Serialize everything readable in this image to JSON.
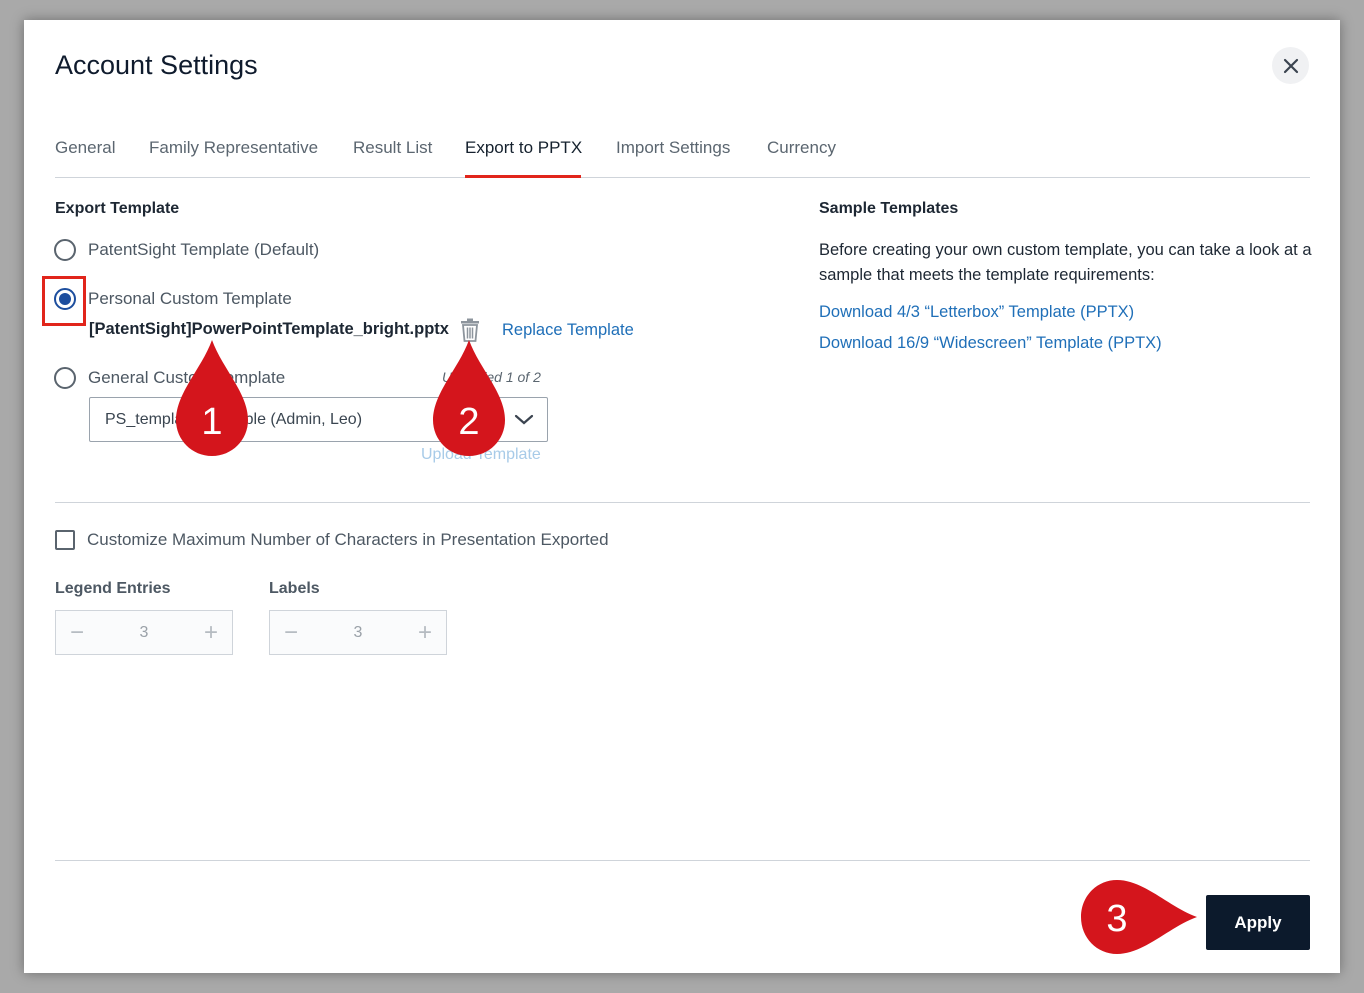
{
  "dialog": {
    "title": "Account Settings"
  },
  "tabs": [
    {
      "label": "General"
    },
    {
      "label": "Family Representative"
    },
    {
      "label": "Result List"
    },
    {
      "label": "Export to PPTX",
      "active": true
    },
    {
      "label": "Import Settings"
    },
    {
      "label": "Currency"
    }
  ],
  "export_template": {
    "title": "Export Template",
    "options": [
      {
        "label": "PatentSight Template (Default)",
        "checked": false
      },
      {
        "label": "Personal Custom Template",
        "checked": true
      },
      {
        "label": "General Custom Template",
        "checked": false
      }
    ],
    "file_name": "[PatentSight]PowerPointTemplate_bright.pptx",
    "replace_label": "Replace Template",
    "uploaded_count": "Uploaded 1 of 2",
    "select_value": "PS_template_example (Admin, Leo)",
    "upload_label": "Upload Template"
  },
  "sample_templates": {
    "title": "Sample Templates",
    "description": "Before creating your own custom template, you can take a look at a sample that meets the template requirements:",
    "links": [
      "Download 4/3 “Letterbox” Template (PPTX)",
      "Download 16/9 “Widescreen” Template (PPTX)"
    ]
  },
  "customize": {
    "checkbox_label": "Customize Maximum Number of Characters in Presentation Exported",
    "checked": false,
    "legend_label": "Legend Entries",
    "legend_value": "3",
    "labels_label": "Labels",
    "labels_value": "3",
    "minus": "−",
    "plus": "+"
  },
  "footer": {
    "apply_label": "Apply"
  },
  "callouts": [
    "1",
    "2",
    "3"
  ],
  "colors": {
    "accent": "#e1251b",
    "link": "#1f6fb8",
    "primary_button": "#0c1a2c",
    "radio_checked": "#1d4e9e"
  }
}
